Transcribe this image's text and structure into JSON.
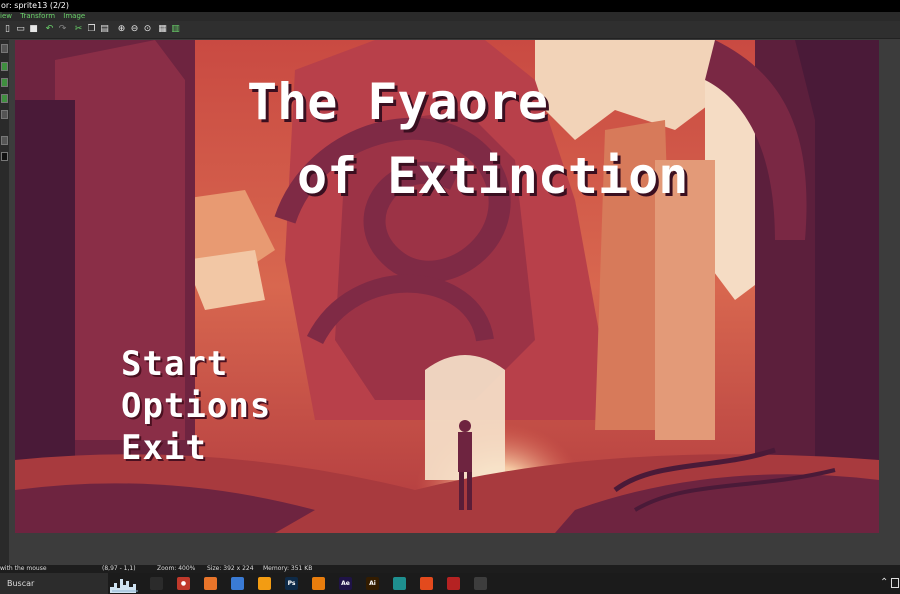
{
  "window": {
    "title": "or: sprite13 (2/2)"
  },
  "menu": {
    "items": [
      "iew",
      "Transform",
      "Image"
    ]
  },
  "toolbar": {
    "icons": [
      "new-icon",
      "open-icon",
      "save-icon",
      "undo-icon",
      "redo-icon",
      "cut-icon",
      "copy-icon",
      "paste-icon",
      "zoom-in-icon",
      "zoom-out-icon",
      "zoom-fit-icon",
      "zoom-actual-icon",
      "grid-icon",
      "tiled-icon"
    ]
  },
  "game": {
    "title_line1": "The Fyaore",
    "title_line2": "of Extinction",
    "menu": [
      "Start",
      "Options",
      "Exit"
    ]
  },
  "status": {
    "hint": "with the mouse",
    "coords": "(8,97 - 1,1)",
    "zoom": "Zoom: 400%",
    "size": "Size: 392 x 224",
    "memory": "Memory: 351 KB"
  },
  "taskbar": {
    "search": "Buscar",
    "apps": [
      {
        "name": "task-view-icon",
        "label": "",
        "color": "#2b2b2b"
      },
      {
        "name": "record-icon",
        "label": "●",
        "color": "#c0392b"
      },
      {
        "name": "firefox-icon",
        "label": "",
        "color": "#e8742a"
      },
      {
        "name": "app-blue-icon",
        "label": "",
        "color": "#3a7bd5"
      },
      {
        "name": "app-orange-icon",
        "label": "",
        "color": "#f39c12"
      },
      {
        "name": "photoshop-icon",
        "label": "Ps",
        "color": "#0e2a47"
      },
      {
        "name": "blender-icon",
        "label": "",
        "color": "#e87d0d"
      },
      {
        "name": "after-effects-icon",
        "label": "Ae",
        "color": "#1f1347"
      },
      {
        "name": "illustrator-icon",
        "label": "Ai",
        "color": "#331c00"
      },
      {
        "name": "app-teal-icon",
        "label": "",
        "color": "#1e8f8f"
      },
      {
        "name": "brave-icon",
        "label": "",
        "color": "#e34a1d"
      },
      {
        "name": "app-red-icon",
        "label": "",
        "color": "#b52222"
      },
      {
        "name": "aseprite-icon",
        "label": "",
        "color": "#3d3d3d"
      }
    ]
  },
  "colors": {
    "dark_maroon": "#4a1a38",
    "red": "#c8423e",
    "salmon": "#e6876a",
    "cream": "#f2d3b8",
    "accent_green": "#6bd36b"
  }
}
